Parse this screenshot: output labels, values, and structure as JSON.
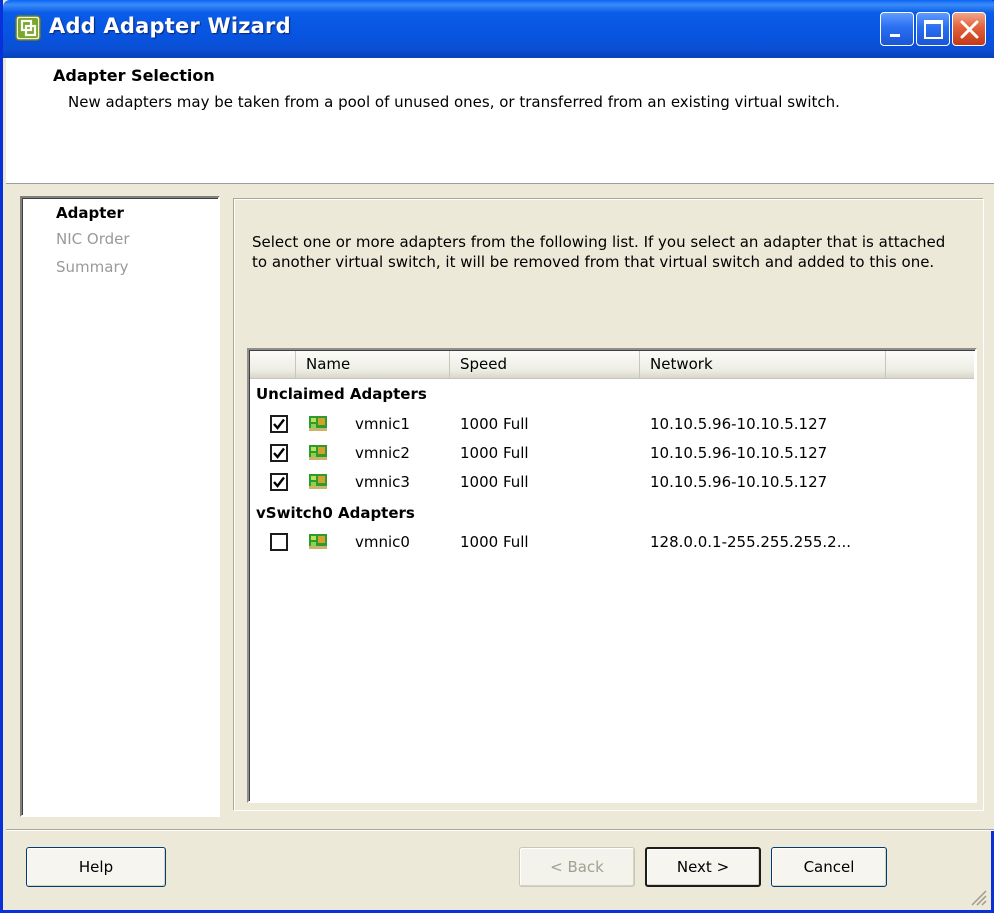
{
  "window": {
    "title": "Add Adapter Wizard",
    "icon": "vsphere-wizard-icon"
  },
  "header": {
    "title": "Adapter Selection",
    "description": "New adapters may be taken from a pool of unused ones, or transferred from an existing virtual switch."
  },
  "steps": [
    {
      "label": "Adapter",
      "active": true
    },
    {
      "label": "NIC Order",
      "active": false
    },
    {
      "label": "Summary",
      "active": false
    }
  ],
  "instructions": "Select one or more adapters from the following list. If you select an adapter that is attached to another virtual switch, it will be removed from that virtual switch and added to this one.",
  "table": {
    "columns": [
      "Name",
      "Speed",
      "Network"
    ],
    "groups": [
      {
        "label": "Unclaimed Adapters",
        "rows": [
          {
            "checked": true,
            "name": "vmnic1",
            "speed": "1000 Full",
            "network": "10.10.5.96-10.10.5.127"
          },
          {
            "checked": true,
            "name": "vmnic2",
            "speed": "1000 Full",
            "network": "10.10.5.96-10.10.5.127"
          },
          {
            "checked": true,
            "name": "vmnic3",
            "speed": "1000 Full",
            "network": "10.10.5.96-10.10.5.127"
          }
        ]
      },
      {
        "label": "vSwitch0 Adapters",
        "rows": [
          {
            "checked": false,
            "name": "vmnic0",
            "speed": "1000 Full",
            "network": "128.0.0.1-255.255.255.2..."
          }
        ]
      }
    ]
  },
  "buttons": {
    "help": "Help",
    "back": "< Back",
    "next": "Next >",
    "cancel": "Cancel"
  },
  "colors": {
    "titlebar": "#0754e0",
    "nic_icon": "#2f9a2f"
  }
}
